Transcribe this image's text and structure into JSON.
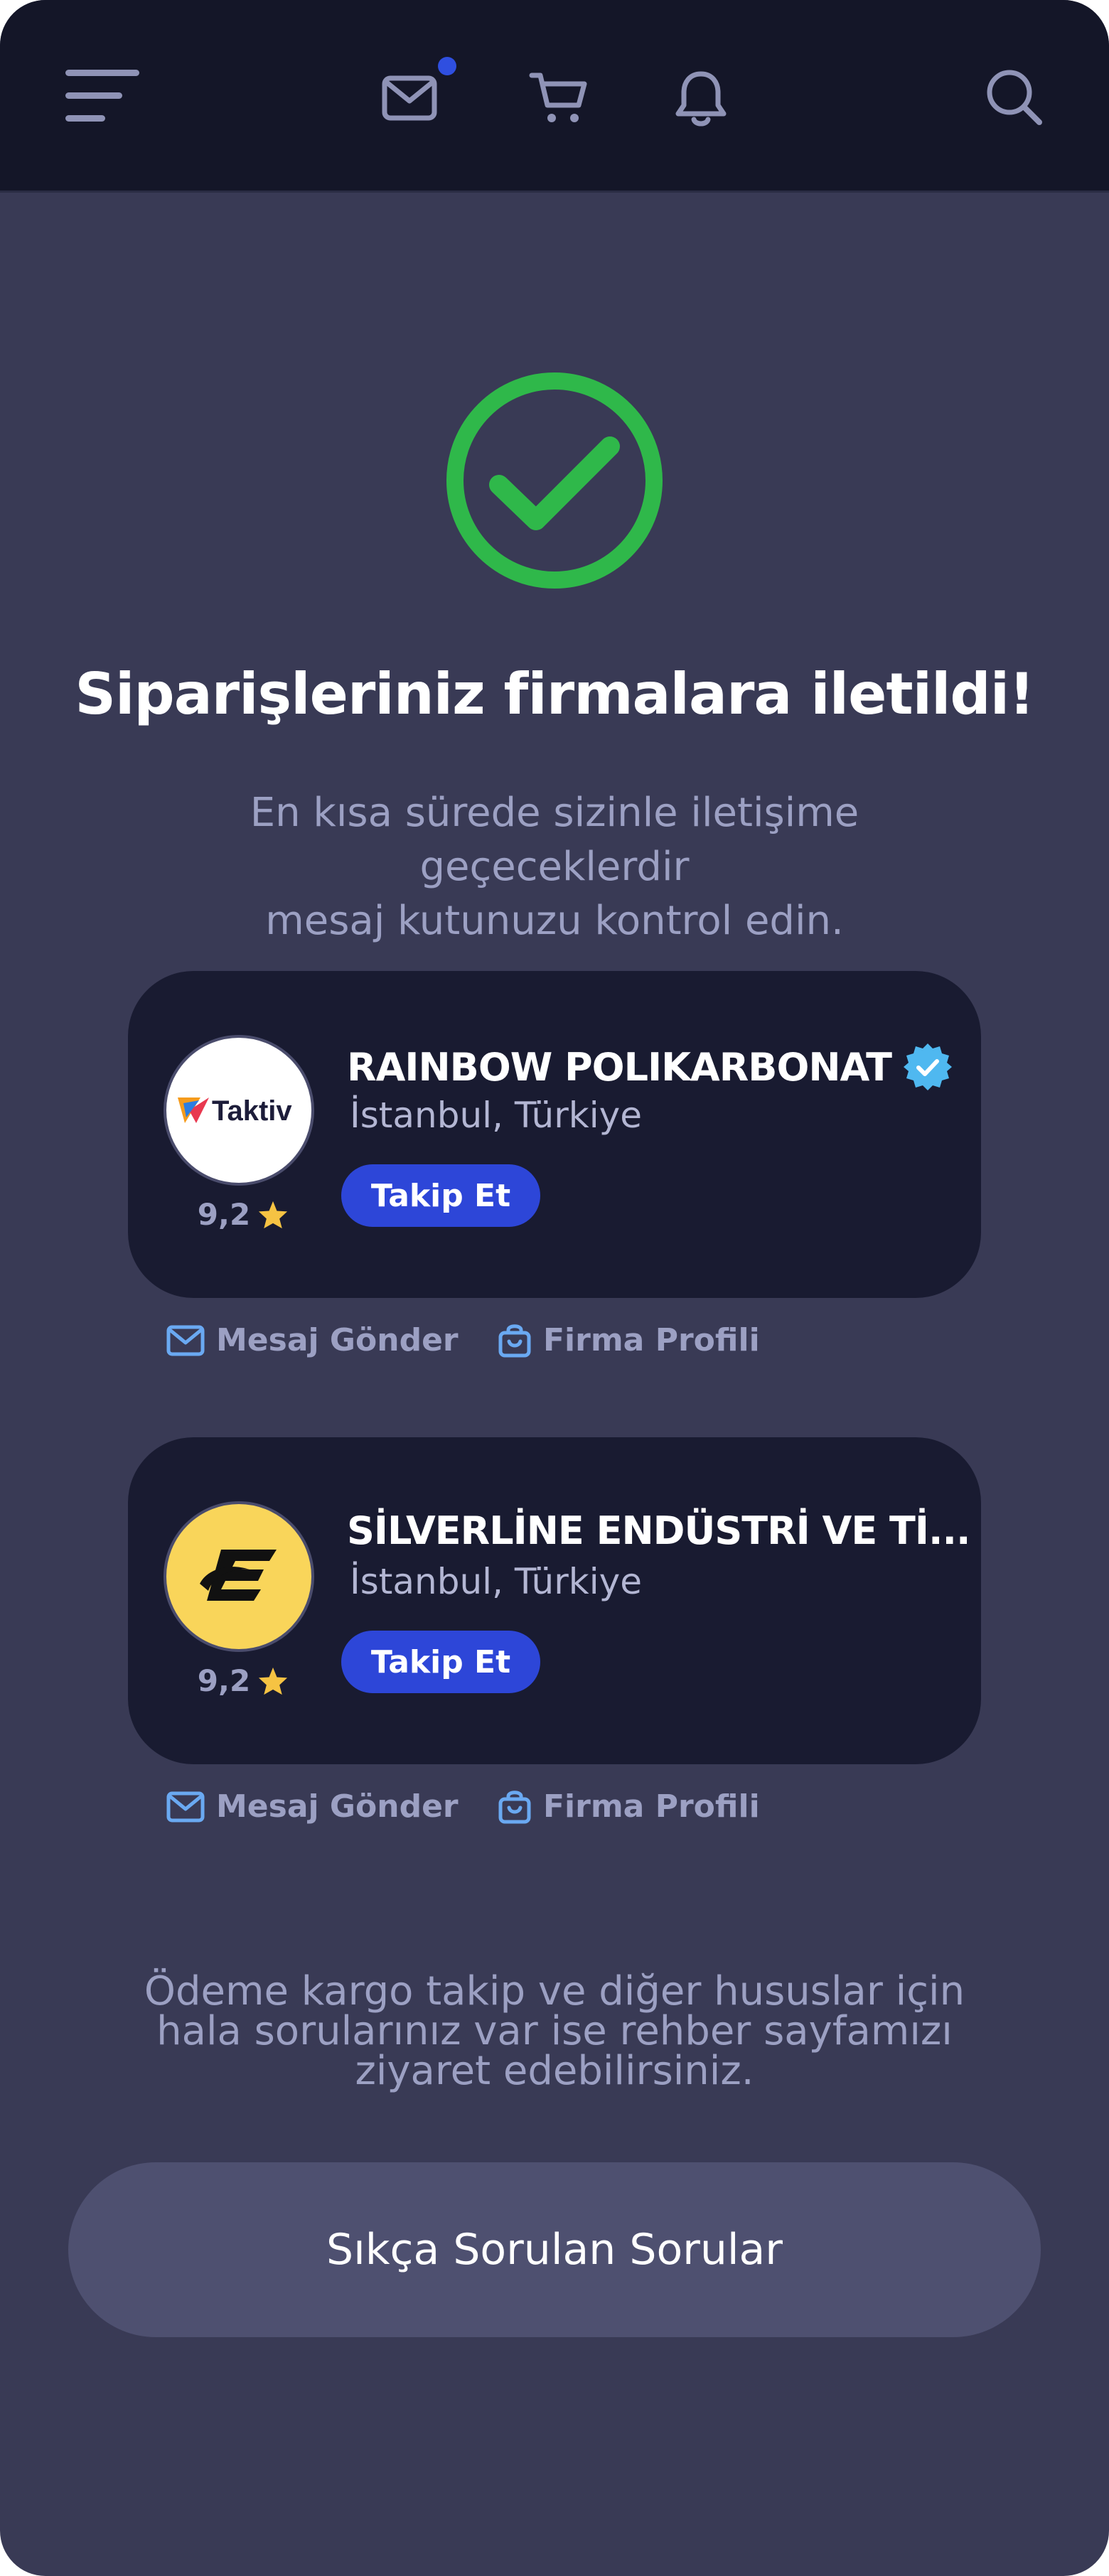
{
  "header": {
    "icons": [
      "menu-icon",
      "mail-icon",
      "cart-icon",
      "bell-icon",
      "search-icon"
    ],
    "notification_color": "#2f4fe0"
  },
  "success": {
    "icon": "check-circle-icon",
    "icon_color": "#2fb84a",
    "title": "Siparişleriniz firmalara iletildi!",
    "subtitle_line1": "En kısa sürede sizinle iletişime geçeceklerdir",
    "subtitle_line2": "mesaj kutunuzu kontrol edin."
  },
  "companies": [
    {
      "name": "RAINBOW POLIKARBONAT",
      "verified": true,
      "location": "İstanbul, Türkiye",
      "rating": "9,2",
      "follow_label": "Takip Et",
      "logo_text": "Taktiv",
      "message_label": "Mesaj Gönder",
      "profile_label": "Firma Profili"
    },
    {
      "name": "SİLVERLİNE ENDÜSTRİ VE Tİ...",
      "verified": false,
      "location": "İstanbul, Türkiye",
      "rating": "9,2",
      "follow_label": "Takip Et",
      "logo_color": "#f9d55a",
      "message_label": "Mesaj Gönder",
      "profile_label": "Firma Profili"
    }
  ],
  "footer": {
    "line1": "Ödeme kargo takip ve diğer hususlar için",
    "line2": "hala sorularınız var ise rehber sayfamızı",
    "line3": "ziyaret edebilirsiniz.",
    "faq_label": "Sıkça Sorulan Sorular"
  },
  "colors": {
    "background": "#393a55",
    "card": "#191b31",
    "topbar": "#141628",
    "accent": "#2d46d8",
    "star": "#f6c343",
    "verified": "#4fb8f0"
  }
}
